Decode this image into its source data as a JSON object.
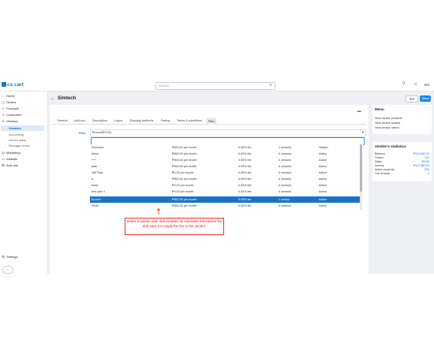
{
  "topbar": {
    "brand": "cs cart",
    "search_placeholder": "Search",
    "user_initials": "EN"
  },
  "sidebar": {
    "items": [
      {
        "label": "Home",
        "icon": "home-icon"
      },
      {
        "label": "Orders",
        "icon": "orders-icon"
      },
      {
        "label": "Products",
        "icon": "products-icon"
      },
      {
        "label": "Customers",
        "icon": "customers-icon"
      },
      {
        "label": "Vendors",
        "icon": "vendors-icon"
      }
    ],
    "active": "Vendors",
    "sub_items": [
      "Accounting",
      "Vendor plans",
      "Message center"
    ],
    "items_after": [
      {
        "label": "Marketing",
        "icon": "marketing-icon"
      },
      {
        "label": "Website",
        "icon": "website-icon"
      },
      {
        "label": "Add-ons",
        "icon": "addons-icon"
      }
    ],
    "settings": "Settings"
  },
  "page": {
    "title": "Simtech",
    "save_label": "Save"
  },
  "tabs": [
    "General",
    "Add-ons",
    "Description",
    "Logos",
    "Shipping methods",
    "Rating",
    "Terms & conditions",
    "Plan"
  ],
  "active_tab": "Plan",
  "plan": {
    "label": "Plan:",
    "selected": "Bronze(₱0.00)"
  },
  "plans_table": [
    [
      "Exclusive",
      "₱500.00 per month",
      "0.00% fee",
      "1 vendors",
      "Hidden"
    ],
    [
      "demo",
      "₱500.00 per month",
      "0.00% fee",
      "0 vendors",
      "Active"
    ],
    [
      "****",
      "₱500.00 per month",
      "0.00% fee",
      "0 vendors",
      "Active"
    ],
    [
      "plan",
      "₱500.00 per month",
      "0.00% fee",
      "0 vendors",
      "Active"
    ],
    [
      "160 Plan",
      "₱0.00 per month",
      "0.00% fee",
      "0 vendors",
      "Active"
    ],
    [
      "a",
      "₱500.00 per month",
      "0.00% fee",
      "0 vendors",
      "Active"
    ],
    [
      "basic",
      "₱0.00 per month",
      "0.00% fee",
      "0 vendors",
      "Active"
    ],
    [
      "test plan 1",
      "₱0.00 per month",
      "0.00% fee",
      "0 vendors",
      "Active"
    ],
    [
      "Bronze",
      "₱500.00 per month",
      "0.00% fee",
      "1 vendor",
      "Active"
    ],
    [
      "Silver",
      "₱500.00 per month",
      "0.00% fee",
      "0 vendors",
      "Active"
    ]
  ],
  "selected_row_index": 8,
  "menu": {
    "title": "Menu",
    "links": [
      "View vendor products",
      "View vendor admins",
      "View vendor orders"
    ]
  },
  "stats": {
    "title": "Vendor's statistics",
    "rows": [
      {
        "label": "Balance",
        "value": "₱112,882.03"
      },
      {
        "label": "Orders",
        "value": "143"
      },
      {
        "label": "Sales",
        "value": "₱0.00"
      },
      {
        "label": "Income",
        "value": "₱112,882.03"
      },
      {
        "label": "Active products",
        "value": "234"
      },
      {
        "label": "Out of stock",
        "value": "4"
      }
    ]
  },
  "callout": {
    "text": "Select a vendor plan that includes an extended transaction fee and save it to apply the fee to the vendor."
  },
  "colors": {
    "accent": "#1a73c9",
    "save_button": "#1a8de8",
    "callout_red": "#e3342f"
  }
}
